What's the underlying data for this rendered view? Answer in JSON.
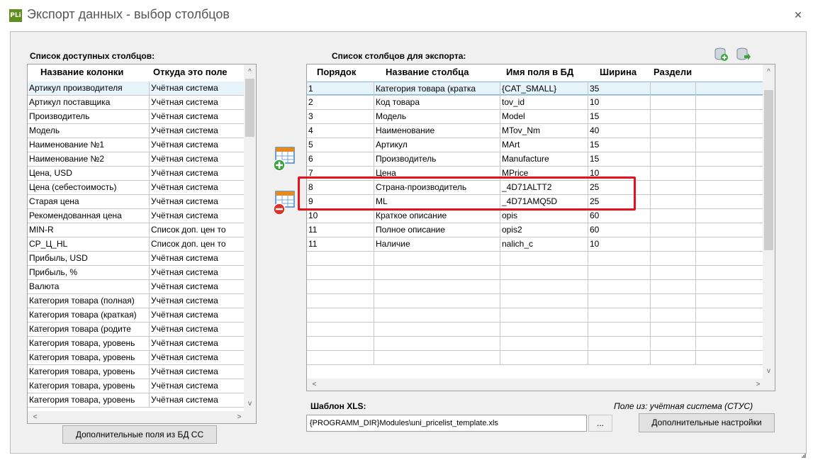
{
  "window": {
    "app_icon": "PLi",
    "title": "Экспорт данных - выбор столбцов",
    "close": "✕"
  },
  "available": {
    "label": "Список доступных столбцов:",
    "headers": [
      "Название колонки",
      "Откуда это поле"
    ],
    "rows": [
      [
        "Артикул производителя",
        "Учётная система"
      ],
      [
        "Артикул поставщика",
        "Учётная система"
      ],
      [
        "Производитель",
        "Учётная система"
      ],
      [
        "Модель",
        "Учётная система"
      ],
      [
        "Наименование №1",
        "Учётная система"
      ],
      [
        "Наименование №2",
        "Учётная система"
      ],
      [
        "Цена, USD",
        "Учётная система"
      ],
      [
        "Цена (себестоимость)",
        "Учётная система"
      ],
      [
        "Старая цена",
        "Учётная система"
      ],
      [
        "Рекомендованная цена",
        "Учётная система"
      ],
      [
        "MIN-R",
        "Список доп. цен то"
      ],
      [
        "СР_Ц_HL",
        "Список доп. цен то"
      ],
      [
        "Прибыль, USD",
        "Учётная система"
      ],
      [
        "Прибыль, %",
        "Учётная система"
      ],
      [
        "Валюта",
        "Учётная система"
      ],
      [
        "Категория товара (полная)",
        "Учётная система"
      ],
      [
        "Категория товара (краткая)",
        "Учётная система"
      ],
      [
        "Категория товара (родите",
        "Учётная система"
      ],
      [
        "Категория товара, уровень",
        "Учётная система"
      ],
      [
        "Категория товара, уровень",
        "Учётная система"
      ],
      [
        "Категория товара, уровень",
        "Учётная система"
      ],
      [
        "Категория товара, уровень",
        "Учётная система"
      ],
      [
        "Категория товара, уровень",
        "Учётная система"
      ]
    ],
    "extra_button": "Дополнительные поля из БД СС"
  },
  "export": {
    "label": "Список столбцов для экспорта:",
    "headers": [
      "Порядок",
      "Название столбца",
      "Имя поля в БД",
      "Ширина",
      "Раздели"
    ],
    "rows": [
      [
        "1",
        "Категория товара (кратка",
        "{CAT_SMALL}",
        "35",
        ""
      ],
      [
        "2",
        "Код товара",
        "tov_id",
        "10",
        ""
      ],
      [
        "3",
        "Модель",
        "Model",
        "15",
        ""
      ],
      [
        "4",
        "Наименование",
        "MTov_Nm",
        "40",
        ""
      ],
      [
        "5",
        "Артикул",
        "MArt",
        "15",
        ""
      ],
      [
        "6",
        "Производитель",
        "Manufacture",
        "15",
        ""
      ],
      [
        "7",
        "Цена",
        "MPrice",
        "10",
        ""
      ],
      [
        "8",
        "Страна-производитель",
        "_4D71ALTT2",
        "25",
        ""
      ],
      [
        "9",
        "ML",
        "_4D71AMQ5D",
        "25",
        ""
      ],
      [
        "10",
        "Краткое описание",
        "opis",
        "60",
        ""
      ],
      [
        "11",
        "Полное описание",
        "opis2",
        "60",
        ""
      ],
      [
        "11",
        "Наличие",
        "nalich_c",
        "10",
        ""
      ]
    ]
  },
  "template": {
    "label": "Шаблон XLS:",
    "value": "{PROGRAMM_DIR}Modules\\uni_pricelist_template.xls",
    "browse": "...",
    "source_note": "Поле из:  учётная система (СТУС)",
    "settings_button": "Дополнительные настройки"
  },
  "scroll": {
    "up": "^",
    "down": "v",
    "left": "<",
    "right": ">"
  },
  "colors": {
    "highlight": "#e8101c",
    "selection": "#e6f3fb"
  }
}
